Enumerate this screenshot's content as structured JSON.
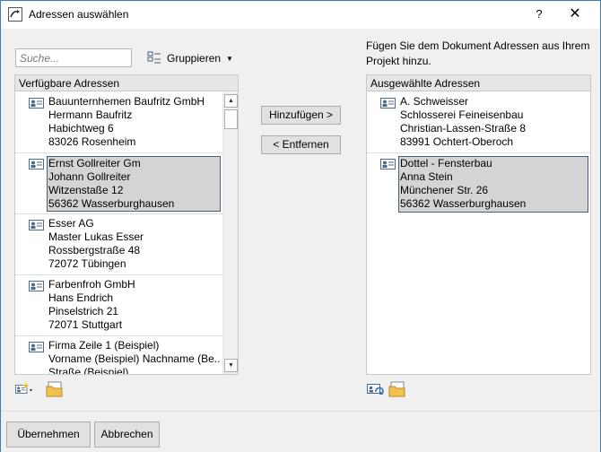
{
  "window": {
    "title": "Adressen auswählen",
    "help_label": "?",
    "close_label": "✕"
  },
  "search": {
    "placeholder": "Suche...",
    "value": ""
  },
  "group": {
    "label": "Gruppieren"
  },
  "info": {
    "text": "Fügen Sie dem Dokument Adressen aus Ihrem Projekt hinzu."
  },
  "available": {
    "header": "Verfügbare Adressen",
    "items": [
      {
        "lines": [
          "Bauunternhemen Baufritz GmbH",
          "Hermann Baufritz",
          "Habichtweg 6",
          "83026 Rosenheim"
        ],
        "selected": false
      },
      {
        "lines": [
          "Ernst Gollreiter Gm",
          "Johann Gollreiter",
          "Witzenstaße 12",
          "56362 Wasserburghausen"
        ],
        "selected": true
      },
      {
        "lines": [
          "Esser AG",
          "Master Lukas Esser",
          "Rossbergstraße 48",
          "72072 Tübingen"
        ],
        "selected": false
      },
      {
        "lines": [
          "Farbenfroh GmbH",
          "Hans Endrich",
          "Pinselstrich 21",
          "72071 Stuttgart"
        ],
        "selected": false
      },
      {
        "lines": [
          "Firma Zeile 1 (Beispiel)",
          "Vorname (Beispiel) Nachname (Be...",
          "Straße (Beispiel)",
          ""
        ],
        "selected": false
      }
    ]
  },
  "selected": {
    "header": "Ausgewählte Adressen",
    "items": [
      {
        "lines": [
          "A. Schweisser",
          "Schlosserei Feineisenbau",
          "Christian-Lassen-Straße 8",
          "83991 Ochtert-Oberoch"
        ],
        "selected": false
      },
      {
        "lines": [
          "Dottel - Fensterbau",
          "Anna Stein",
          "Münchener Str. 26",
          "56362 Wasserburghausen"
        ],
        "selected": true
      }
    ]
  },
  "buttons": {
    "add": "Hinzufügen >",
    "remove": "< Entfernen",
    "apply": "Übernehmen",
    "cancel": "Abbrechen"
  },
  "scroll": {
    "up": "▲",
    "down": "▼"
  },
  "icons": {
    "app": "app-icon",
    "card": "address-card-icon",
    "group": "group-icon",
    "new_address": "new-address-icon",
    "folder": "folder-icon",
    "refresh": "refresh-address-icon"
  }
}
